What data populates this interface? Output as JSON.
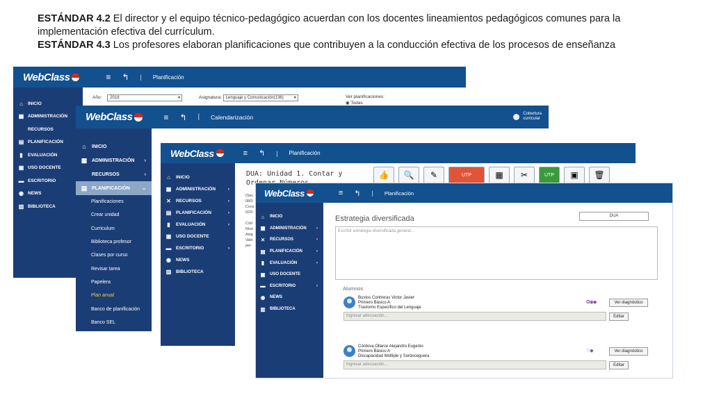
{
  "header": {
    "std1_code": "ESTÁNDAR 4.2",
    "std1_text": " El director y el equipo técnico-pedagógico acuerdan con los docentes lineamientos pedagógicos comunes para la implementación efectiva del currículum.",
    "std2_code": "ESTÁNDAR 4.3",
    "std2_text": " Los profesores elaboran planificaciones que contribuyen a la conducción efectiva de los procesos de enseñanza"
  },
  "brand": {
    "logo_text": "WebClass",
    "menu_glyph": "≡",
    "back_glyph": "↰",
    "separator": "|"
  },
  "colors": {
    "topbar": "#13508e",
    "sidebar": "#1b3d75",
    "active_submenu": "#f4d03f"
  },
  "window1": {
    "title": "Planificación",
    "sidebar": [
      {
        "icon": "home-icon",
        "glyph": "⌂",
        "label": "INICIO"
      },
      {
        "icon": "admin-icon",
        "glyph": "▦",
        "label": "ADMINISTRACIÓN"
      },
      {
        "icon": "",
        "glyph": "",
        "label": "RECURSOS"
      },
      {
        "icon": "planning-icon",
        "glyph": "▤",
        "label": "PLANIFICACIÓN"
      },
      {
        "icon": "chart-icon",
        "glyph": "▮",
        "label": "EVALUACIÓN"
      },
      {
        "icon": "monitor-icon",
        "glyph": "▣",
        "label": "USO DOCENTE"
      },
      {
        "icon": "desk-icon",
        "glyph": "▬",
        "label": "ESCRITORIO"
      },
      {
        "icon": "news-icon",
        "glyph": "◉",
        "label": "NEWS"
      },
      {
        "icon": "books-icon",
        "glyph": "▥",
        "label": "BIBLIOTECA"
      }
    ],
    "form": {
      "year_label": "Año:",
      "year_value": "2018",
      "subject_label": "Asignatura:",
      "subject_value": "Lenguaje y Comunicación(136)",
      "view_label": "Ver planificaciones:",
      "view_option": "Todas"
    }
  },
  "window2": {
    "title": "Calendarización",
    "cobertura_line1": "Cobertura",
    "cobertura_line2": "curricular",
    "sidebar": [
      {
        "icon": "home-icon",
        "glyph": "⌂",
        "label": "INICIO",
        "chevron": ""
      },
      {
        "icon": "admin-icon",
        "glyph": "▦",
        "label": "ADMINISTRACIÓN",
        "chevron": "›"
      },
      {
        "icon": "",
        "glyph": "",
        "label": "RECURSOS",
        "chevron": "›"
      },
      {
        "icon": "planning-icon",
        "glyph": "▤",
        "label": "PLANIFICACIÓN",
        "chevron": "⌄"
      }
    ],
    "submenu": [
      "Planificaciones",
      "Crear unidad",
      "Curriculum",
      "Biblioteca profesor",
      "Clases por curso",
      "Revisar tarea",
      "Papelera",
      "Plan anual",
      "Banco de planificación",
      "Banco SEL"
    ],
    "active_submenu_index": 7
  },
  "window3": {
    "title": "Planificación",
    "dua_title": "DUA: Unidad 1. Contar y Ordenar Números",
    "toolbar": [
      {
        "icon": "thumbs-up-icon",
        "glyph": "👍"
      },
      {
        "icon": "search-icon",
        "glyph": "🔍"
      },
      {
        "icon": "edit-icon",
        "glyph": "✎"
      },
      {
        "icon": "utp-icon",
        "glyph": "UTP"
      },
      {
        "icon": "chart-icon",
        "glyph": "▦"
      },
      {
        "icon": "tools-icon",
        "glyph": "✂"
      },
      {
        "icon": "utp-green-icon",
        "glyph": "UTP"
      },
      {
        "icon": "computer-icon",
        "glyph": "▣"
      },
      {
        "icon": "trash-icon",
        "glyph": "🗑"
      }
    ],
    "snippets": [
      "(Sec",
      "08/0",
      "Crea",
      "02/0",
      "",
      "Cód",
      "Nive",
      "Asig",
      "Valo",
      "per"
    ],
    "sidebar": [
      {
        "icon": "home-icon",
        "glyph": "⌂",
        "label": "INICIO",
        "chevron": ""
      },
      {
        "icon": "admin-icon",
        "glyph": "▦",
        "label": "ADMINISTRACIÓN",
        "chevron": "›"
      },
      {
        "icon": "tools-icon",
        "glyph": "✕",
        "label": "RECURSOS",
        "chevron": "›"
      },
      {
        "icon": "planning-icon",
        "glyph": "▤",
        "label": "PLANIFICACIÓN",
        "chevron": "›"
      },
      {
        "icon": "chart-icon",
        "glyph": "▮",
        "label": "EVALUACIÓN",
        "chevron": "›"
      },
      {
        "icon": "monitor-icon",
        "glyph": "▣",
        "label": "USO DOCENTE",
        "chevron": ""
      },
      {
        "icon": "desk-icon",
        "glyph": "▬",
        "label": "ESCRITORIO",
        "chevron": "›"
      },
      {
        "icon": "news-icon",
        "glyph": "◉",
        "label": "NEWS",
        "chevron": ""
      },
      {
        "icon": "books-icon",
        "glyph": "▥",
        "label": "BIBLIOTECA",
        "chevron": ""
      }
    ]
  },
  "window4": {
    "title": "Planificación",
    "section_title": "Estrategia diversificada",
    "dua_badge": "DUA",
    "textarea_placeholder": "Escribir estrategia diversificada general...",
    "alumnos_label": "Alumnos",
    "students": [
      {
        "name": "Bustos Contreras Victor Javier",
        "course": "Primero Básico A",
        "condition": "Trastorno Específico del Lenguaje",
        "icons": "❂◉◆"
      },
      {
        "name": "Córdova Ollarce Alejandro Eugenio",
        "course": "Primero Básico A",
        "condition": "Discapacidad Múltiple y Sordoceguera",
        "icons": "♡◆"
      }
    ],
    "diag_button": "Ver diagnóstico",
    "edit_button": "Editar",
    "adecuacion_placeholder": "Ingresar adecuación...",
    "sidebar": [
      {
        "icon": "home-icon",
        "glyph": "⌂",
        "label": "INICIO",
        "chevron": ""
      },
      {
        "icon": "admin-icon",
        "glyph": "▦",
        "label": "ADMINISTRACIÓN",
        "chevron": "›"
      },
      {
        "icon": "tools-icon",
        "glyph": "✕",
        "label": "RECURSOS",
        "chevron": "›"
      },
      {
        "icon": "planning-icon",
        "glyph": "▤",
        "label": "PLANIFICACIÓN",
        "chevron": "›"
      },
      {
        "icon": "chart-icon",
        "glyph": "▮",
        "label": "EVALUACIÓN",
        "chevron": "›"
      },
      {
        "icon": "monitor-icon",
        "glyph": "▣",
        "label": "USO DOCENTE",
        "chevron": ""
      },
      {
        "icon": "desk-icon",
        "glyph": "▬",
        "label": "ESCRITORIO",
        "chevron": "›"
      },
      {
        "icon": "news-icon",
        "glyph": "◉",
        "label": "NEWS",
        "chevron": ""
      },
      {
        "icon": "books-icon",
        "glyph": "▥",
        "label": "BIBLIOTECA",
        "chevron": ""
      }
    ]
  }
}
